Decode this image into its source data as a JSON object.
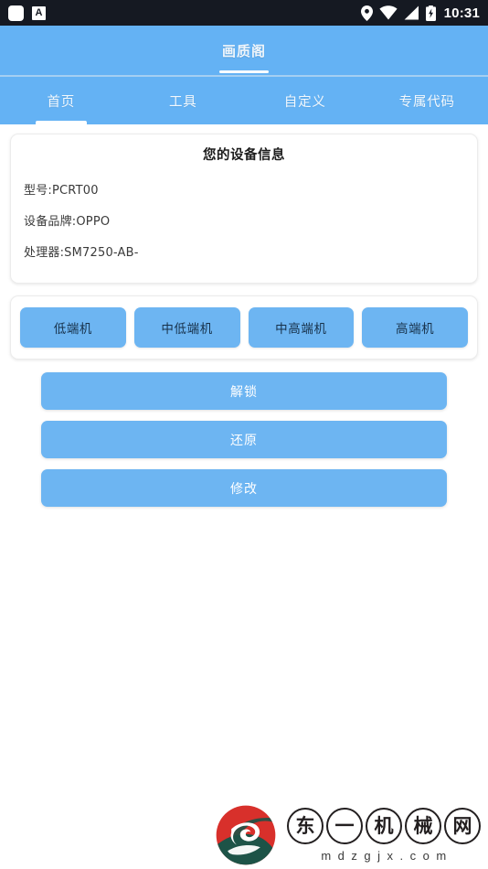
{
  "status_bar": {
    "left_icons": [
      "note-icon",
      "input-method-a-icon"
    ],
    "right_icons": [
      "location-pin-icon",
      "wifi-icon",
      "signal-icon",
      "battery-charging-icon"
    ],
    "a_icon_label": "A",
    "time": "10:31"
  },
  "app_bar": {
    "title": "画质阁"
  },
  "tabs": [
    {
      "label": "首页",
      "active": true
    },
    {
      "label": "工具",
      "active": false
    },
    {
      "label": "自定义",
      "active": false
    },
    {
      "label": "专属代码",
      "active": false
    }
  ],
  "device_card": {
    "title": "您的设备信息",
    "lines": [
      "型号:PCRT00",
      "设备品牌:OPPO",
      "处理器:SM7250-AB-"
    ]
  },
  "tier_buttons": [
    {
      "label": "低端机"
    },
    {
      "label": "中低端机"
    },
    {
      "label": "中高端机"
    },
    {
      "label": "高端机"
    }
  ],
  "action_buttons": [
    {
      "label": "解锁"
    },
    {
      "label": "还原"
    },
    {
      "label": "修改"
    }
  ],
  "watermark": {
    "characters": [
      "东",
      "一",
      "机",
      "械",
      "网"
    ],
    "url": "mdzgjx.com"
  },
  "colors": {
    "accent_blue": "#64b2f4",
    "button_blue": "#6db5f2",
    "status_bar": "#151922",
    "page_background": "#ffffff",
    "emblem_red": "#d8302b",
    "emblem_green": "#1d5347"
  }
}
